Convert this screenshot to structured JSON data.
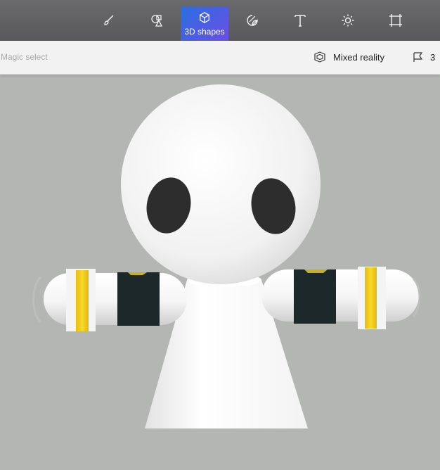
{
  "toolbar": {
    "tools": [
      {
        "icon": "brush-icon"
      },
      {
        "icon": "2d-shapes-icon"
      },
      {
        "icon": "3d-shapes-icon",
        "label": "3D shapes",
        "active": true
      },
      {
        "icon": "stickers-icon"
      },
      {
        "icon": "text-icon"
      },
      {
        "icon": "effects-icon"
      },
      {
        "icon": "canvas-icon"
      }
    ],
    "active_gradient": [
      "#2b6fe0",
      "#6a4ee6"
    ]
  },
  "subbar": {
    "magic_select": "Magic select",
    "mixed_reality": "Mixed reality",
    "three_d_library": "3"
  },
  "colors": {
    "canvas_bg": "#b4b6b4",
    "band_yellow": "#f6d120",
    "band_dark": "#1c2829",
    "eye": "#2d2d2d"
  }
}
